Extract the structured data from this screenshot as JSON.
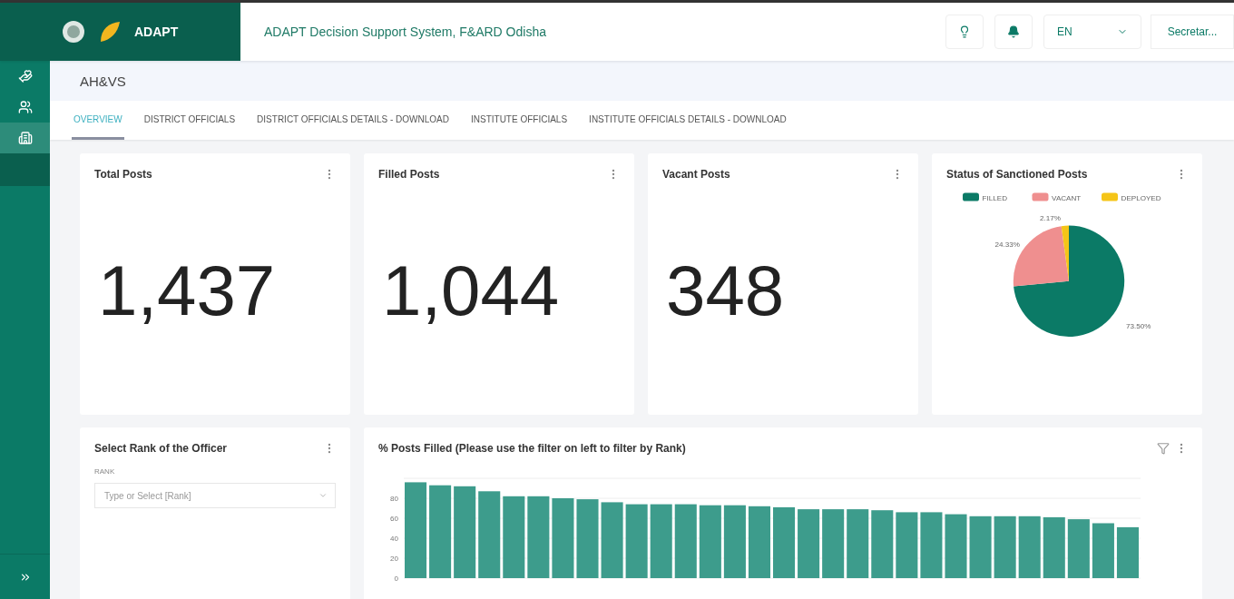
{
  "header": {
    "title": "ADAPT Decision Support System, F&ARD Odisha",
    "logo_text": "ADAPT",
    "language": "EN",
    "user": "Secretar..."
  },
  "sidebar": {
    "items": [
      {
        "kind": "hand",
        "selected": false
      },
      {
        "kind": "group",
        "selected": false
      },
      {
        "kind": "office",
        "selected": true
      }
    ]
  },
  "page": {
    "title": "AH&VS"
  },
  "tabs": [
    {
      "label": "OVERVIEW",
      "selected": true
    },
    {
      "label": "DISTRICT OFFICIALS",
      "selected": false
    },
    {
      "label": "DISTRICT OFFICIALS DETAILS - DOWNLOAD",
      "selected": false
    },
    {
      "label": "INSTITUTE OFFICIALS",
      "selected": false
    },
    {
      "label": "INSTITUTE OFFICIALS DETAILS - DOWNLOAD",
      "selected": false
    }
  ],
  "kpis": [
    {
      "title": "Total Posts",
      "value": "1,437"
    },
    {
      "title": "Filled Posts",
      "value": "1,044"
    },
    {
      "title": "Vacant Posts",
      "value": "348"
    }
  ],
  "status_chart": {
    "title": "Status of Sanctioned Posts",
    "chart_data": {
      "type": "pie",
      "categories": [
        "FILLED",
        "VACANT",
        "DEPLOYED"
      ],
      "values": [
        73.5,
        24.33,
        2.17
      ],
      "colors": [
        "#0b7a66",
        "#ef8f8f",
        "#f5c518"
      ],
      "legend": "top",
      "value_labels": [
        "73.50%",
        "24.33%",
        "2.17%"
      ]
    }
  },
  "rank_filter": {
    "title": "Select Rank of the Officer",
    "label": "RANK",
    "placeholder": "Type or Select [Rank]"
  },
  "posts_chart": {
    "title": "% Posts Filled (Please use the filter on left to filter by Rank)",
    "chart_data": {
      "type": "bar",
      "grid": true,
      "ylim": [
        0,
        100
      ],
      "yticks": [
        0,
        20,
        40,
        60,
        80
      ],
      "series": [
        {
          "color": "#3d9c8c",
          "values": [
            96,
            93,
            92,
            87,
            82,
            82,
            80,
            79,
            76,
            74,
            74,
            74,
            73,
            73,
            72,
            71,
            69,
            69,
            69,
            68,
            66,
            66,
            64,
            62,
            62,
            62,
            61,
            59,
            55,
            51
          ]
        }
      ]
    }
  }
}
